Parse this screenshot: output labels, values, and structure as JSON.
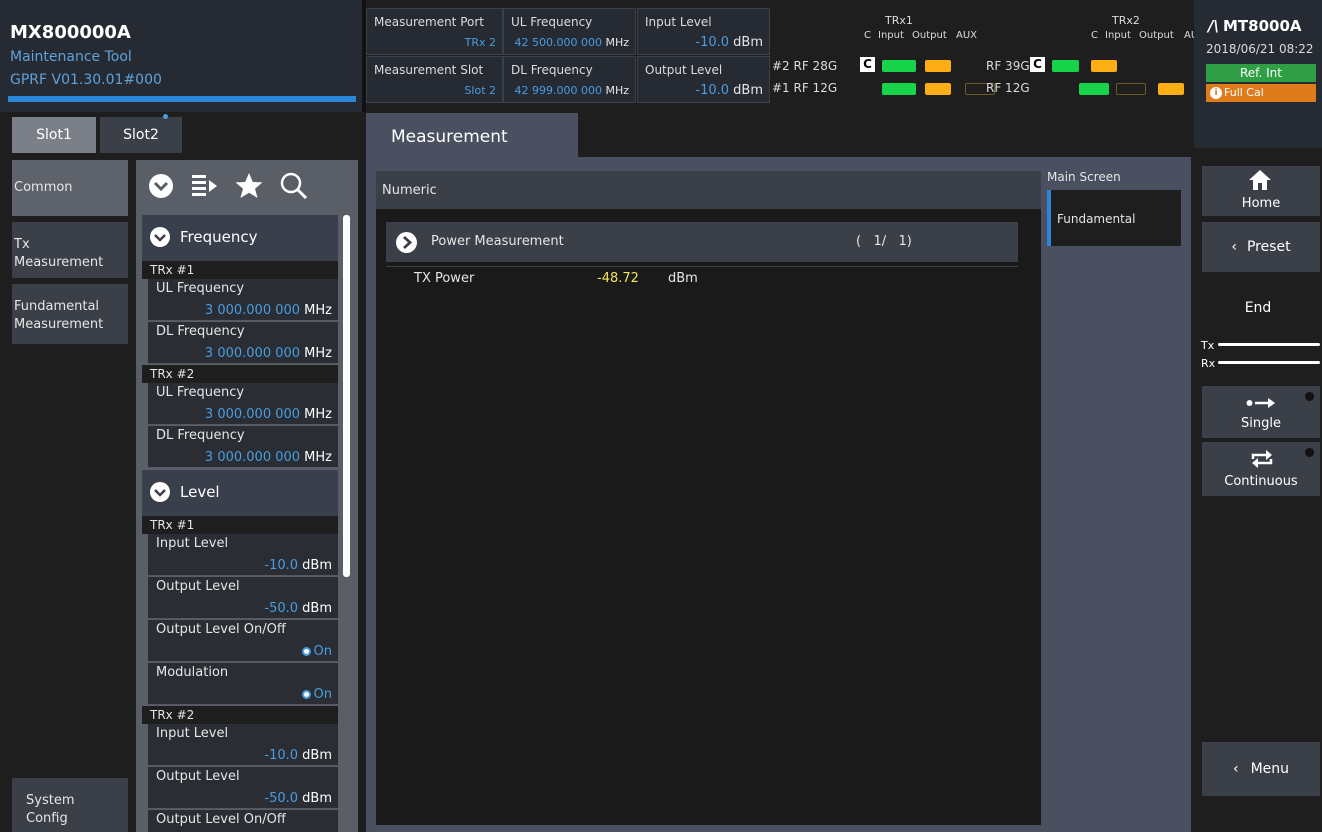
{
  "app": {
    "model": "MX800000A",
    "name": "Maintenance Tool",
    "version": "GPRF V01.30.01#000"
  },
  "header": {
    "meas_port_label": "Measurement Port",
    "meas_port_value": "TRx 2",
    "meas_slot_label": "Measurement Slot",
    "meas_slot_value": "Slot 2",
    "ul_freq_label": "UL Frequency",
    "ul_freq_value": "42 500.000 000",
    "ul_freq_unit": "MHz",
    "dl_freq_label": "DL Frequency",
    "dl_freq_value": "42 999.000 000",
    "dl_freq_unit": "MHz",
    "input_level_label": "Input Level",
    "input_level_value": "-10.0",
    "input_level_unit": "dBm",
    "output_level_label": "Output Level",
    "output_level_value": "-10.0",
    "output_level_unit": "dBm"
  },
  "trx": {
    "trx1_title": "TRx1",
    "trx2_title": "TRx2",
    "col_c": "C",
    "col_input": "Input",
    "col_output": "Output",
    "col_aux": "AUX",
    "row2_label_trx1": "#2  RF 28G",
    "row1_label_trx1": "#1  RF 12G",
    "row2_label_trx2": "RF 39G",
    "row1_label_trx2": "RF 12G",
    "c_badge": "C",
    "colors": {
      "green": "#17d44a",
      "orange": "#ffad14"
    }
  },
  "brand": {
    "name": "MT8000A",
    "datetime": "2018/06/21 08:22",
    "ref": "Ref. Int",
    "fullcal": "Full Cal"
  },
  "slots": {
    "slot1": "Slot1",
    "slot2": "Slot2"
  },
  "left_nav": {
    "common": "Common",
    "tx_meas_1": "Tx",
    "tx_meas_2": "Measurement",
    "fund_meas_1": "Fundamental",
    "fund_meas_2": "Measurement",
    "sys_1": "System",
    "sys_2": "Config"
  },
  "settings": {
    "frequency_title": "Frequency",
    "level_title": "Level",
    "trx1": "TRx #1",
    "trx2": "TRx #2",
    "ul_freq": "UL Frequency",
    "dl_freq": "DL Frequency",
    "freq_value": "3 000.000 000",
    "freq_unit": "MHz",
    "input_level": "Input Level",
    "output_level": "Output Level",
    "output_onoff": "Output Level On/Off",
    "modulation": "Modulation",
    "input_level_value": "-10.0",
    "output_level_value": "-50.0",
    "level_unit": "dBm",
    "on": "On"
  },
  "main": {
    "tab": "Measurement",
    "panel_title": "Numeric",
    "group_name": "Power Measurement",
    "group_page": "(   1/   1)",
    "tx_power_label": "TX Power",
    "tx_power_value": "-48.72",
    "tx_power_unit": "dBm"
  },
  "screen_list": {
    "title": "Main Screen",
    "item": "Fundamental"
  },
  "right": {
    "home": "Home",
    "preset": "Preset",
    "end": "End",
    "tx": "Tx",
    "rx": "Rx",
    "single": "Single",
    "continuous": "Continuous",
    "menu": "Menu"
  }
}
